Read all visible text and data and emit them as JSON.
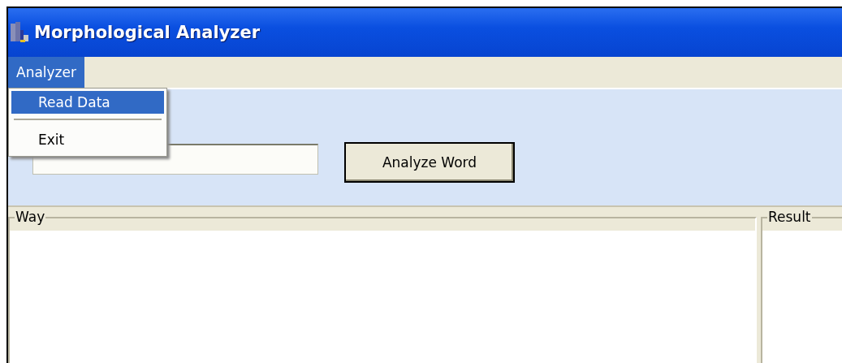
{
  "window": {
    "title": "Morphological Analyzer"
  },
  "menu_bar": [
    {
      "label": "Analyzer",
      "selected": true
    }
  ],
  "open_menu": [
    {
      "kind": "item",
      "label": "Read Data",
      "selected": true
    },
    {
      "kind": "separator"
    },
    {
      "kind": "item",
      "label": "Exit",
      "selected": false
    }
  ],
  "analyze_button": {
    "label": "Analyze Word"
  },
  "groups": [
    {
      "label": "Way"
    },
    {
      "label": "Result"
    }
  ]
}
